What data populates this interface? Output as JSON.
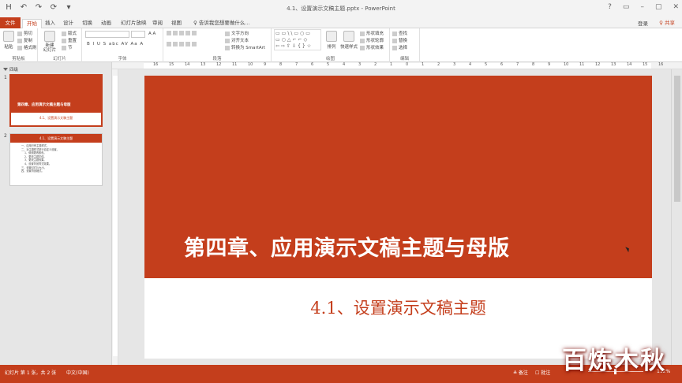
{
  "app": {
    "window_title": "4.1、设置演示文稿主题.pptx - PowerPoint",
    "login": "登录",
    "share": "♀ 共享"
  },
  "qat": [
    "H",
    "↶",
    "↷",
    "⟳",
    "▾"
  ],
  "winctl": [
    "?",
    "▭",
    "–",
    "▢",
    "✕"
  ],
  "tabs": [
    "文件",
    "开始",
    "插入",
    "设计",
    "切换",
    "动画",
    "幻灯片放映",
    "审阅",
    "视图"
  ],
  "tell_me": "♀ 告诉我您想要做什么...",
  "ribbon": {
    "clipboard": {
      "label": "剪贴板",
      "paste": "粘贴",
      "cut": "剪切",
      "copy": "复制",
      "format_painter": "格式刷"
    },
    "slides": {
      "label": "幻灯片",
      "new_slide": "新建\n幻灯片",
      "layout": "版式",
      "reset": "重置",
      "section": "节"
    },
    "font": {
      "label": "字体",
      "buttons": "B  I  U  S  abc  AV  Aa  A"
    },
    "paragraph": {
      "label": "段落",
      "text_direction": "文字方向",
      "align_text": "对齐文本",
      "smartart": "转换为 SmartArt"
    },
    "drawing": {
      "label": "绘图",
      "arrange": "排列",
      "quick_styles": "快速样式",
      "shape_fill": "形状填充",
      "shape_outline": "形状轮廓",
      "shape_effects": "形状效果",
      "shapes_gallery": "▭▭\\\\▭○▭\n▭○△⌐⌐◇\n⇦⇨⇧⇩{}☆"
    },
    "editing": {
      "label": "编辑",
      "find": "查找",
      "replace": "替换",
      "select": "选择"
    }
  },
  "ruler_numbers": [
    "16",
    "15",
    "14",
    "13",
    "12",
    "11",
    "10",
    "9",
    "8",
    "7",
    "6",
    "5",
    "4",
    "3",
    "2",
    "1",
    "0",
    "1",
    "2",
    "3",
    "4",
    "5",
    "6",
    "7",
    "8",
    "9",
    "10",
    "11",
    "12",
    "13",
    "14",
    "15",
    "16"
  ],
  "sections": {
    "name": "四级"
  },
  "slides": [
    {
      "num": "1",
      "title": "第四章、应用演示文稿主题与母版",
      "subtitle": "4.1、设置演示文稿主题"
    },
    {
      "num": "2",
      "title": "4.1、设置演示文稿主题",
      "list": "一、应用已有主题样式。\n二、对主题样式进行自定义设置。\n    1、使用更改颜色。\n    2、更改主题字体。\n    3、更改主题效果。\n    4、设置背景样式效果。\n三、设置幻灯片大小。\n四、设置背景格式。"
    }
  ],
  "main_slide": {
    "title": "第四章、应用演示文稿主题与母版",
    "subtitle": "4.1、设置演示文稿主题"
  },
  "status": {
    "slide_of": "幻灯片 第 1 张，共 2 张",
    "language": "中文(中国)",
    "notes": "≜ 备注",
    "comments": "☐ 批注",
    "zoom": "112%"
  },
  "watermark": "百炼木秋",
  "colors": {
    "accent": "#c43e1c",
    "ribbon_bg": "#ffffff",
    "chrome": "#f3f3f3"
  }
}
